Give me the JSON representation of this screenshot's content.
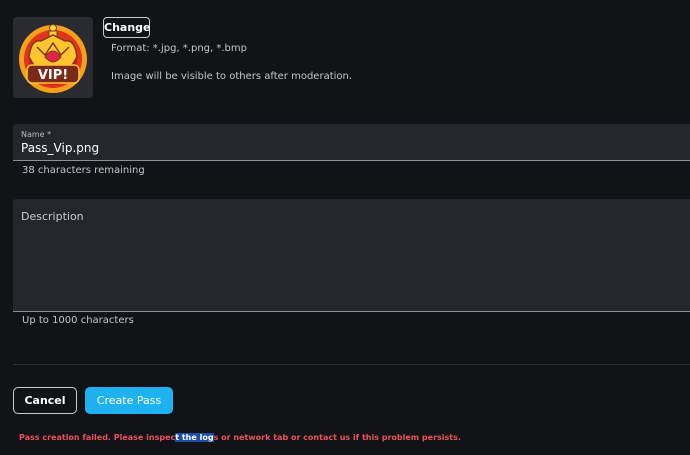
{
  "image": {
    "badge_text": "VIP!",
    "icon": "vip-crown-icon",
    "change_label": "Change",
    "format_text": "Format: *.jpg, *.png, *.bmp",
    "moderation_text": "Image will be visible to others after moderation."
  },
  "name_field": {
    "label": "Name *",
    "value": "Pass_Vip.png",
    "helper": "38 characters remaining"
  },
  "description_field": {
    "placeholder": "Description",
    "value": "",
    "helper": "Up to 1000 characters"
  },
  "actions": {
    "cancel_label": "Cancel",
    "create_label": "Create Pass"
  },
  "error": {
    "before": "Pass creation failed. Please inspec",
    "selected": "t the log",
    "after": "s or network tab or contact us if this problem persists."
  },
  "colors": {
    "background": "#121316",
    "field": "#24262b",
    "primary": "#1fb2f2",
    "error": "#e9535d",
    "selection": "#1a4fa8"
  }
}
